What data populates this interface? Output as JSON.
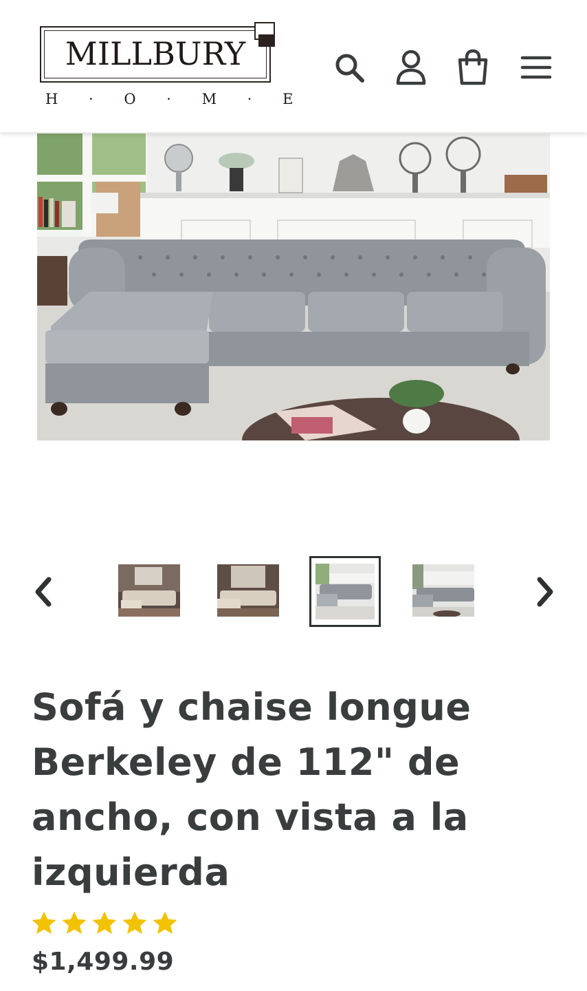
{
  "brand": {
    "name": "MILLBURY",
    "tagline": "H · O · M · E"
  },
  "header": {
    "icons": [
      "search-icon",
      "account-icon",
      "cart-icon",
      "menu-icon"
    ]
  },
  "gallery": {
    "main_image": "gray tufted chesterfield sectional sofa with left chaise in a living room",
    "thumbnails": [
      {
        "name": "thumb-1",
        "active": false
      },
      {
        "name": "thumb-2",
        "active": false
      },
      {
        "name": "thumb-3",
        "active": true
      },
      {
        "name": "thumb-4",
        "active": false
      }
    ],
    "prev_icon": "chevron-left-icon",
    "next_icon": "chevron-right-icon"
  },
  "product": {
    "title_lines": [
      "Sofá y chaise longue",
      "Berkeley de 112\" de",
      "ancho, con vista a la",
      "izquierda"
    ],
    "rating": 5,
    "rating_max": 5,
    "price": "$1,499.99"
  },
  "colors": {
    "text": "#3a3d3e",
    "star": "#f2c200",
    "logo": "#1f1a18"
  }
}
